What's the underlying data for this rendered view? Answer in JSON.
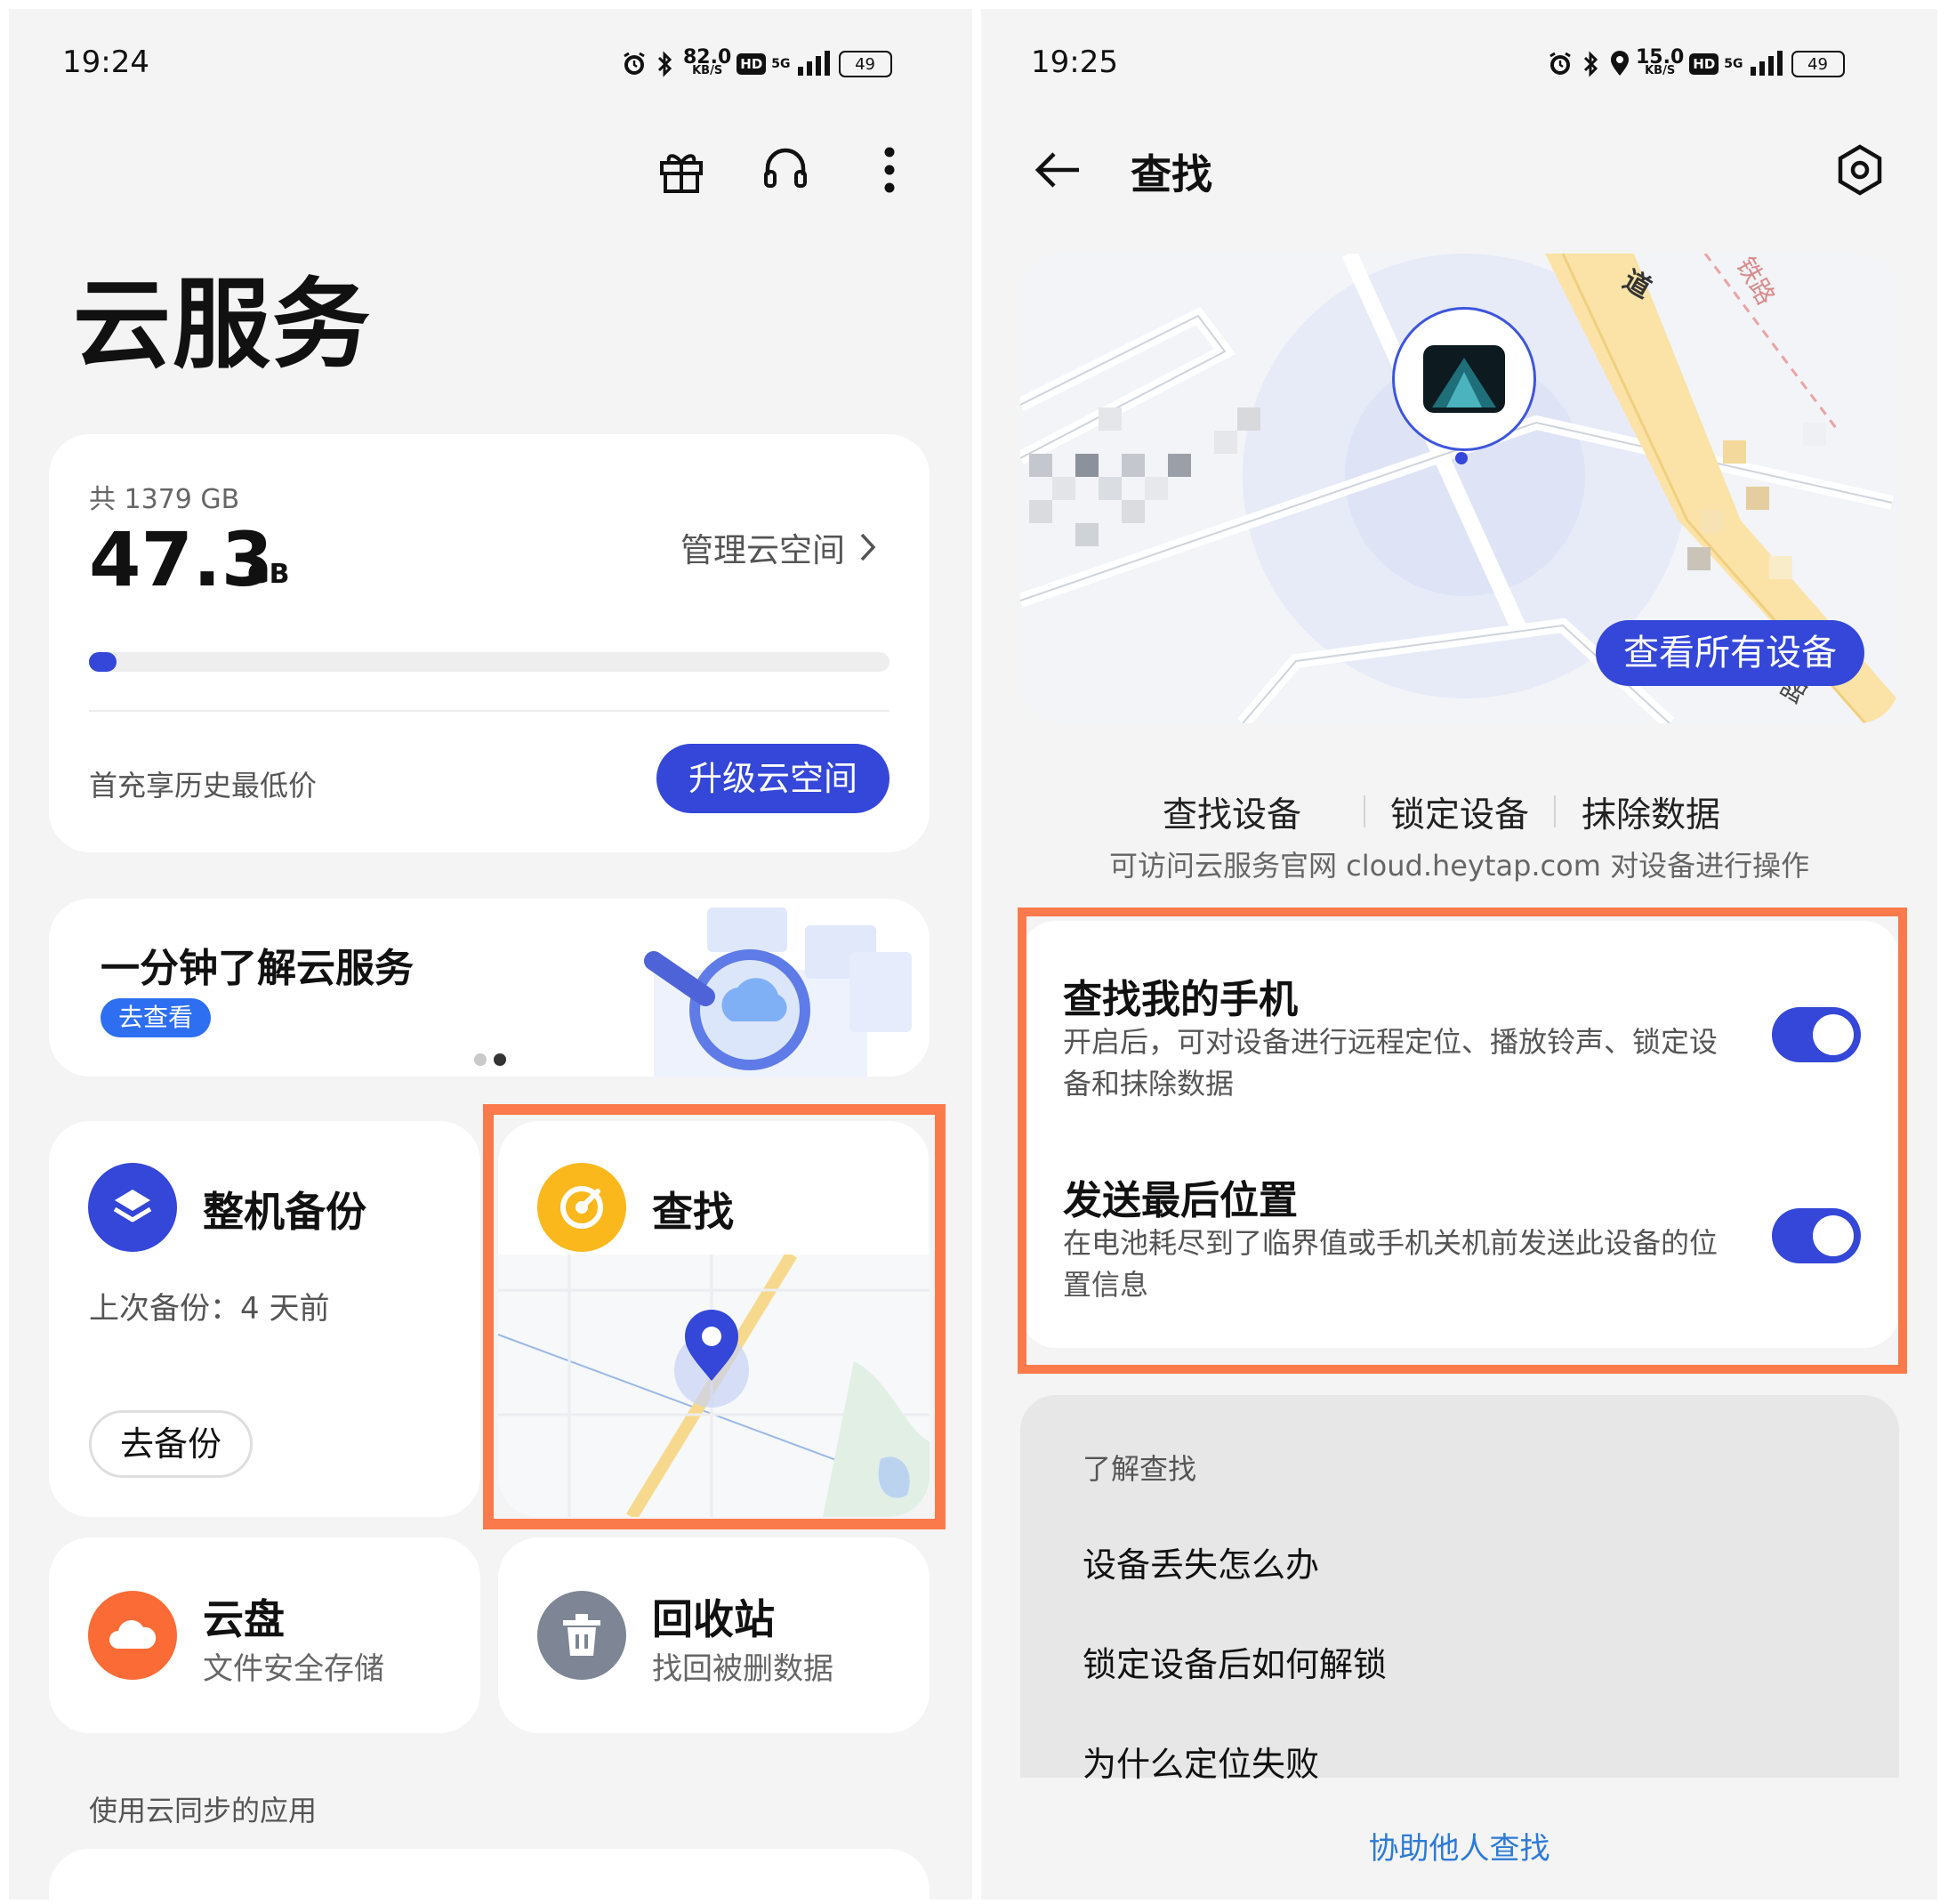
{
  "left": {
    "status": {
      "time": "19:24",
      "speed": "82.0",
      "speed_unit": "KB/S",
      "hd": "HD",
      "net": "5G",
      "battery": "49"
    },
    "toolbar": {
      "gift_icon": "gift-icon",
      "support_icon": "headset-icon",
      "more_icon": "more-vertical-icon"
    },
    "title": "云服务",
    "storage": {
      "total": "共 1379 GB",
      "used_value": "47.3",
      "used_unit": "GB",
      "manage_label": "管理云空间",
      "used_fraction": 0.034,
      "promo_text": "首充享历史最低价",
      "upgrade_label": "升级云空间"
    },
    "banner": {
      "title": "一分钟了解云服务",
      "button_label": "去查看",
      "page_count": 2,
      "active_page": 2
    },
    "backup": {
      "title": "整机备份",
      "last_backup": "上次备份：4 天前",
      "button_label": "去备份"
    },
    "find": {
      "title": "查找"
    },
    "drive": {
      "title": "云盘",
      "subtitle": "文件安全存储"
    },
    "recycle": {
      "title": "回收站",
      "subtitle": "找回被删数据"
    },
    "synced_apps_header": "使用云同步的应用"
  },
  "right": {
    "status": {
      "time": "19:25",
      "speed": "15.0",
      "speed_unit": "KB/S",
      "hd": "HD",
      "net": "5G",
      "battery": "49"
    },
    "header": {
      "title": "查找",
      "back_icon": "arrow-left-icon",
      "settings_icon": "settings-hexagon-icon"
    },
    "map": {
      "view_all_label": "查看所有设备",
      "road_label_1": "道",
      "road_label_2": "铁路",
      "road_label_3": "路"
    },
    "actions": [
      "查找设备",
      "锁定设备",
      "抹除数据"
    ],
    "actions_hint": "可访问云服务官网 cloud.heytap.com 对设备进行操作",
    "settings": [
      {
        "title": "查找我的手机",
        "desc": "开启后，可对设备进行远程定位、播放铃声、锁定设备和抹除数据",
        "enabled": true
      },
      {
        "title": "发送最后位置",
        "desc": "在电池耗尽到了临界值或手机关机前发送此设备的位置信息",
        "enabled": true
      }
    ],
    "learn": {
      "header": "了解查找",
      "items": [
        "设备丢失怎么办",
        "锁定设备后如何解锁",
        "为什么定位失败"
      ]
    },
    "help_link": "协助他人查找"
  },
  "colors": {
    "accent": "#3447d8",
    "highlight": "#fb7a4c",
    "find_yellow": "#fbb81c",
    "drive_orange": "#fb6b36",
    "recycle_gray": "#7e8594",
    "link": "#2d7bd6"
  }
}
